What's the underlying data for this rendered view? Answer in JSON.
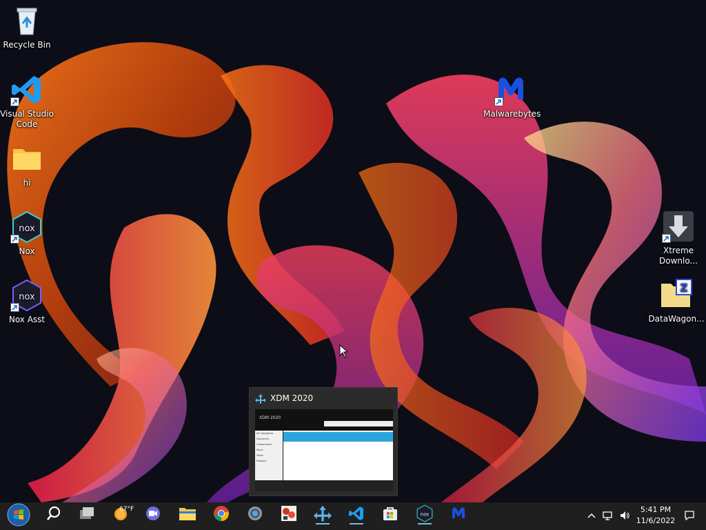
{
  "desktop": {
    "icons_left": [
      {
        "label": "Recycle Bin",
        "icon": "recycle-bin-icon"
      },
      {
        "label": "Visual Studio Code",
        "icon": "vscode-icon"
      },
      {
        "label": "hi",
        "icon": "folder-icon"
      },
      {
        "label": "Nox",
        "icon": "nox-icon"
      },
      {
        "label": "Nox Asst",
        "icon": "nox-asst-icon"
      }
    ],
    "icons_right": [
      {
        "label": "Malwarebytes",
        "icon": "malwarebytes-icon"
      },
      {
        "label": "Xtreme Downlo...",
        "icon": "xtreme-download-icon"
      },
      {
        "label": "DataWagon...",
        "icon": "datawagon-icon"
      }
    ]
  },
  "preview": {
    "title": "XDM 2020",
    "mini_title": "XDM 2020",
    "sidebar": [
      "All Categories",
      "Document",
      "Compressed",
      "Music",
      "Video",
      "Program"
    ]
  },
  "taskbar": {
    "weather_temp": "67°F",
    "buttons": [
      {
        "name": "start",
        "icon": "windows-logo-icon"
      },
      {
        "name": "search",
        "icon": "search-icon"
      },
      {
        "name": "task-view",
        "icon": "task-view-icon"
      },
      {
        "name": "weather",
        "icon": "weather-icon"
      },
      {
        "name": "teams-chat",
        "icon": "video-chat-icon"
      },
      {
        "name": "file-explorer",
        "icon": "folder-icon"
      },
      {
        "name": "chrome",
        "icon": "chrome-icon"
      },
      {
        "name": "settings",
        "icon": "gear-icon"
      },
      {
        "name": "game",
        "icon": "game-app-icon"
      },
      {
        "name": "xdm",
        "icon": "xdm-icon"
      },
      {
        "name": "vscode",
        "icon": "vscode-icon"
      },
      {
        "name": "store",
        "icon": "store-icon"
      },
      {
        "name": "nox",
        "icon": "nox-icon"
      },
      {
        "name": "malwarebytes",
        "icon": "malwarebytes-icon"
      }
    ],
    "clock": {
      "time": "5:41 PM",
      "date": "11/6/2022"
    }
  },
  "colors": {
    "taskbar": "#1f1f1f",
    "accent": "#76b9ed",
    "wallpaper_base": "#0c0d16"
  }
}
